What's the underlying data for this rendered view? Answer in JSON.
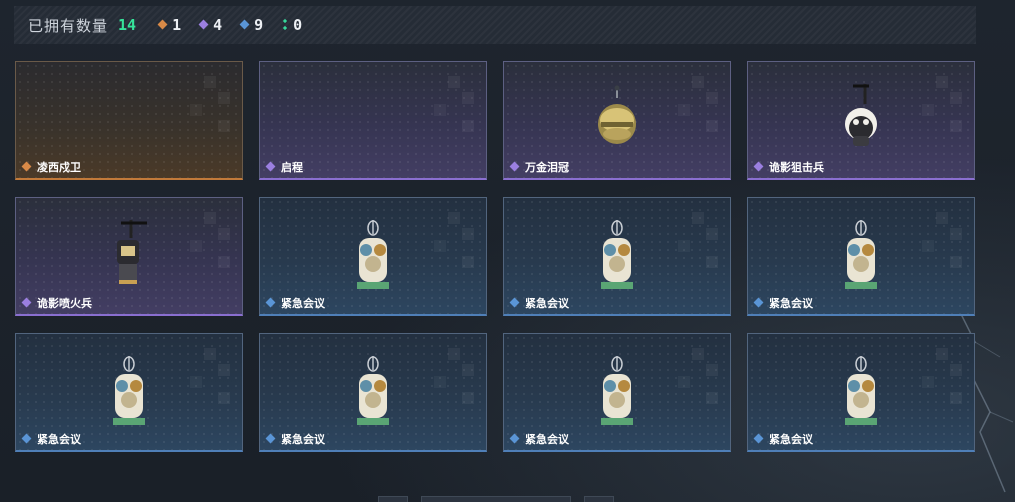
{
  "summary": {
    "title": "已拥有数量",
    "total": "14",
    "counts": [
      {
        "rarity": "orange",
        "color": "#d98a47",
        "value": "1",
        "icon": "orange-rarity-diamond-icon"
      },
      {
        "rarity": "purple",
        "color": "#9b7fe0",
        "value": "4",
        "icon": "purple-rarity-diamond-icon"
      },
      {
        "rarity": "blue",
        "color": "#5a95d6",
        "value": "9",
        "icon": "blue-rarity-diamond-icon"
      },
      {
        "rarity": "green",
        "color": "#37d89a",
        "value": "0",
        "icon": "green-rarity-icon"
      }
    ]
  },
  "colors": {
    "orange": "#d98a47",
    "purple": "#9b7fe0",
    "blue": "#5a95d6",
    "total_green": "#36e39a"
  },
  "items": [
    {
      "name": "凌西戍卫",
      "rarity": "orange",
      "art": "none"
    },
    {
      "name": "启程",
      "rarity": "purple",
      "art": "none"
    },
    {
      "name": "万金泪冠",
      "rarity": "purple",
      "art": "golden-egg-charm"
    },
    {
      "name": "诡影狙击兵",
      "rarity": "purple",
      "art": "sniper-charm"
    },
    {
      "name": "诡影喷火兵",
      "rarity": "purple",
      "art": "flamer-charm"
    },
    {
      "name": "紧急会议",
      "rarity": "blue",
      "art": "meeting-charm"
    },
    {
      "name": "紧急会议",
      "rarity": "blue",
      "art": "meeting-charm"
    },
    {
      "name": "紧急会议",
      "rarity": "blue",
      "art": "meeting-charm"
    },
    {
      "name": "紧急会议",
      "rarity": "blue",
      "art": "meeting-charm"
    },
    {
      "name": "紧急会议",
      "rarity": "blue",
      "art": "meeting-charm"
    },
    {
      "name": "紧急会议",
      "rarity": "blue",
      "art": "meeting-charm"
    },
    {
      "name": "紧急会议",
      "rarity": "blue",
      "art": "meeting-charm"
    }
  ]
}
